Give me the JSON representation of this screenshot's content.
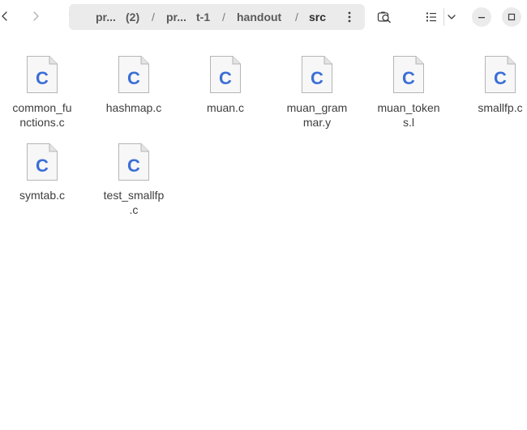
{
  "navigation": {
    "back_icon": "chevron-left-icon",
    "forward_icon": "chevron-right-icon"
  },
  "pathbar": {
    "segments": [
      "pr...",
      "(2)",
      "pr...",
      "t-1",
      "handout",
      "src"
    ],
    "separator": "/",
    "menu_icon": "vertical-dots-icon"
  },
  "toolbar": {
    "search_icon": "search-icon",
    "view_icon": "list-view-icon",
    "view_menu_icon": "chevron-down-icon",
    "minimize_icon": "minimize-icon",
    "maximize_icon": "maximize-icon"
  },
  "files": [
    {
      "name": "common_functions.c",
      "line1": "common_fu",
      "line2": "nctions.c",
      "icon_letter": "C"
    },
    {
      "name": "hashmap.c",
      "line1": "hashmap.c",
      "line2": "",
      "icon_letter": "C"
    },
    {
      "name": "muan.c",
      "line1": "muan.c",
      "line2": "",
      "icon_letter": "C"
    },
    {
      "name": "muan_grammar.y",
      "line1": "muan_gram",
      "line2": "mar.y",
      "icon_letter": "C"
    },
    {
      "name": "muan_tokens.l",
      "line1": "muan_token",
      "line2": "s.l",
      "icon_letter": "C"
    },
    {
      "name": "smallfp.c",
      "line1": "smallfp.c",
      "line2": "",
      "icon_letter": "C"
    },
    {
      "name": "symtab.c",
      "line1": "symtab.c",
      "line2": "",
      "icon_letter": "C"
    },
    {
      "name": "test_smallfp.c",
      "line1": "test_smallfp",
      "line2": ".c",
      "icon_letter": "C"
    }
  ],
  "colors": {
    "c_letter": "#3c6fd6",
    "page_fill": "#f7f7f7",
    "page_stroke": "#b5b5b5"
  }
}
